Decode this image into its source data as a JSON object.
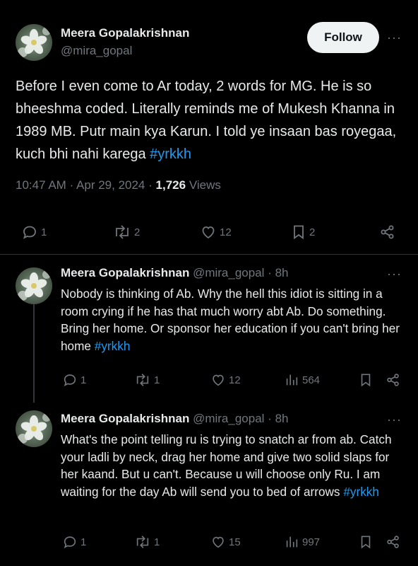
{
  "main_tweet": {
    "author_name": "Meera Gopalakrishnan",
    "handle": "@mira_gopal",
    "follow_label": "Follow",
    "text_parts": {
      "body": "Before I even come to Ar today, 2 words for MG. He is so bheeshma coded. Literally reminds me of Mukesh Khanna in 1989 MB. Putr main kya Karun. I told ye insaan bas royegaa, kuch bhi nahi karega ",
      "hashtag": "#yrkkh"
    },
    "time": "10:47 AM",
    "date": "Apr 29, 2024",
    "views_count": "1,726",
    "views_label": "Views",
    "stats": {
      "replies": "1",
      "reposts": "2",
      "likes": "12",
      "bookmarks": "2"
    }
  },
  "replies": [
    {
      "author_name": "Meera Gopalakrishnan",
      "handle": "@mira_gopal",
      "age": "8h",
      "body": "Nobody is thinking of Ab. Why the hell this idiot is sitting in a room crying if he has that much worry abt Ab. Do something. Bring her home. Or sponsor her education if you can't bring her home ",
      "hashtag": "#yrkkh",
      "stats": {
        "replies": "1",
        "reposts": "1",
        "likes": "12",
        "views": "564"
      }
    },
    {
      "author_name": "Meera Gopalakrishnan",
      "handle": "@mira_gopal",
      "age": "8h",
      "body": "What's the point telling ru is trying to snatch ar from ab. Catch your ladli by neck, drag her home and give two solid slaps for her kaand. But u can't. Because u will choose only Ru. I am waiting for the day Ab will send you to bed of arrows ",
      "hashtag": "#yrkkh",
      "stats": {
        "replies": "1",
        "reposts": "1",
        "likes": "15",
        "views": "997"
      }
    }
  ],
  "ui": {
    "separator_dot": "·",
    "more_glyph": "···",
    "icons": [
      "reply-icon",
      "repost-icon",
      "like-icon",
      "bookmark-icon",
      "share-icon",
      "views-icon",
      "more-icon"
    ],
    "colors": {
      "background": "#000000",
      "text": "#e7e9ea",
      "muted": "#71767b",
      "link": "#1d9bf0",
      "follow_bg": "#eff3f4"
    }
  }
}
